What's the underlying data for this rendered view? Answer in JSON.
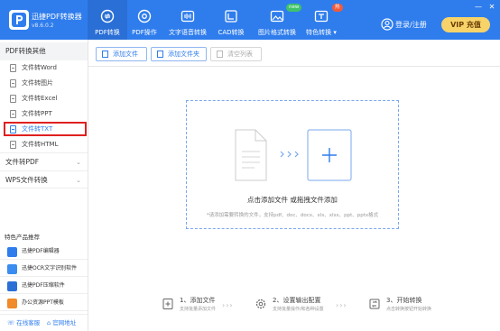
{
  "app": {
    "name": "迅捷PDF转换器",
    "version": "v8.6.0.2"
  },
  "nav": {
    "tabs": [
      {
        "label": "PDF转换",
        "icon": "convert-icon"
      },
      {
        "label": "PDF操作",
        "icon": "pdf-operate-icon"
      },
      {
        "label": "文字语音转换",
        "icon": "audio-wave-icon"
      },
      {
        "label": "CAD转换",
        "icon": "cad-icon"
      },
      {
        "label": "图片格式转换",
        "icon": "image-icon",
        "badge": "new"
      },
      {
        "label": "特色转换",
        "icon": "special-icon",
        "badge": "热"
      }
    ],
    "active_index": 0
  },
  "account": {
    "login_label": "登录/注册",
    "vip_label": "VIP 充值"
  },
  "window": {
    "minimize": "—",
    "close": "✕"
  },
  "sidebar": {
    "group1": "PDF转换其他",
    "items": [
      "文件转Word",
      "文件转图片",
      "文件转Excel",
      "文件转PPT",
      "文件转TXT",
      "文件转HTML"
    ],
    "selected_index": 4,
    "group2": "文件转PDF",
    "group3": "WPS文件转换",
    "products_title": "特色产品推荐",
    "products": [
      {
        "label": "迅捷PDF编辑器",
        "color": "#2f7ded"
      },
      {
        "label": "迅捷OCR文字识别软件",
        "color": "#3b8cf0"
      },
      {
        "label": "迅捷PDF压缩软件",
        "color": "#2a6fd6"
      },
      {
        "label": "办公资源PPT模板",
        "color": "#f08a2a"
      }
    ],
    "footer": {
      "service": "在线客服",
      "website": "官网地址"
    }
  },
  "toolbar": {
    "add_file": "添加文件",
    "add_folder": "添加文件夹",
    "clear_list": "清空列表"
  },
  "dropzone": {
    "main_text": "点击添加文件 或拖拽文件添加",
    "sub_text": "*请添加需要转换的文件，支持pdf、doc、docx、xls、xlsx、ppt、pptx格式"
  },
  "steps": [
    {
      "title": "1、添加文件",
      "desc": "支持批量添加文件"
    },
    {
      "title": "2、设置输出配置",
      "desc": "支持批量操作/和各种设置"
    },
    {
      "title": "3、开始转换",
      "desc": "点击转换按钮开始转换"
    }
  ],
  "colors": {
    "brand": "#2f7ded",
    "highlight": "#e02020",
    "vip": "#f7d36a"
  }
}
